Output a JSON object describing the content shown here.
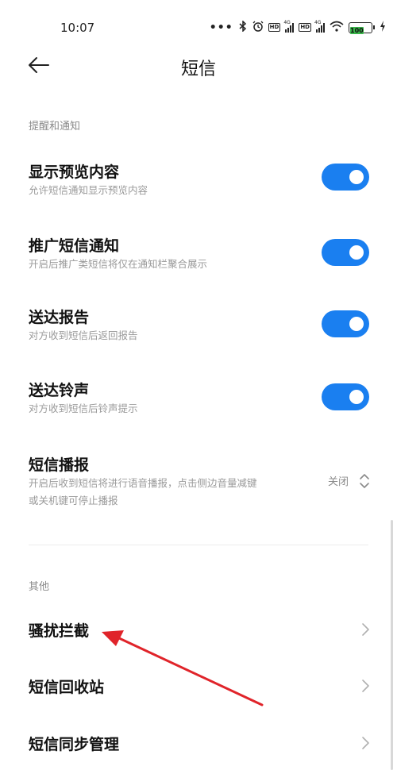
{
  "status_bar": {
    "time": "10:07",
    "dots": "•••",
    "hd1": "HD",
    "hd2": "HD",
    "net1": "4G",
    "net2": "4G",
    "battery": "100"
  },
  "header": {
    "title": "短信"
  },
  "sections": {
    "notify_title": "提醒和通知",
    "other_title": "其他"
  },
  "settings": {
    "preview": {
      "title": "显示预览内容",
      "subtitle": "允许短信通知显示预览内容",
      "enabled": true
    },
    "promo": {
      "title": "推广短信通知",
      "subtitle": "开启后推广类短信将仅在通知栏聚合展示",
      "enabled": true
    },
    "report": {
      "title": "送达报告",
      "subtitle": "对方收到短信后返回报告",
      "enabled": true
    },
    "ringtone": {
      "title": "送达铃声",
      "subtitle": "对方收到短信后铃声提示",
      "enabled": true
    },
    "broadcast": {
      "title": "短信播报",
      "subtitle_line1": "开启后收到短信将进行语音播报，点击侧边音量减键",
      "subtitle_line2": "或关机键可停止播报",
      "value": "关闭"
    }
  },
  "other": {
    "spam": "骚扰拦截",
    "recycle": "短信回收站",
    "sync": "短信同步管理"
  },
  "colors": {
    "accent": "#1a7ff0",
    "annotation_arrow": "#e0242a"
  }
}
